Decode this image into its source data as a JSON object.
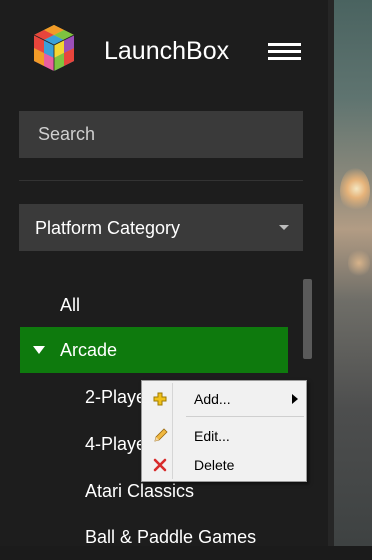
{
  "header": {
    "app_title": "LaunchBox"
  },
  "search": {
    "placeholder": "Search"
  },
  "filter": {
    "selected": "Platform Category"
  },
  "tree": {
    "items": [
      {
        "label": "All"
      },
      {
        "label": "Arcade",
        "selected": true,
        "expanded": true
      },
      {
        "label": "2-Player Games"
      },
      {
        "label": "4-Player Games"
      },
      {
        "label": "Atari Classics"
      },
      {
        "label": "Ball & Paddle Games"
      }
    ]
  },
  "context_menu": {
    "items": [
      {
        "label": "Add...",
        "icon": "add-icon",
        "has_submenu": true
      },
      {
        "label": "Edit...",
        "icon": "pencil-icon"
      },
      {
        "label": "Delete",
        "icon": "delete-x-icon"
      }
    ]
  },
  "colors": {
    "selection": "#0e7a0d",
    "sidebar": "#1d1d1d",
    "field": "#3a3a3a"
  }
}
